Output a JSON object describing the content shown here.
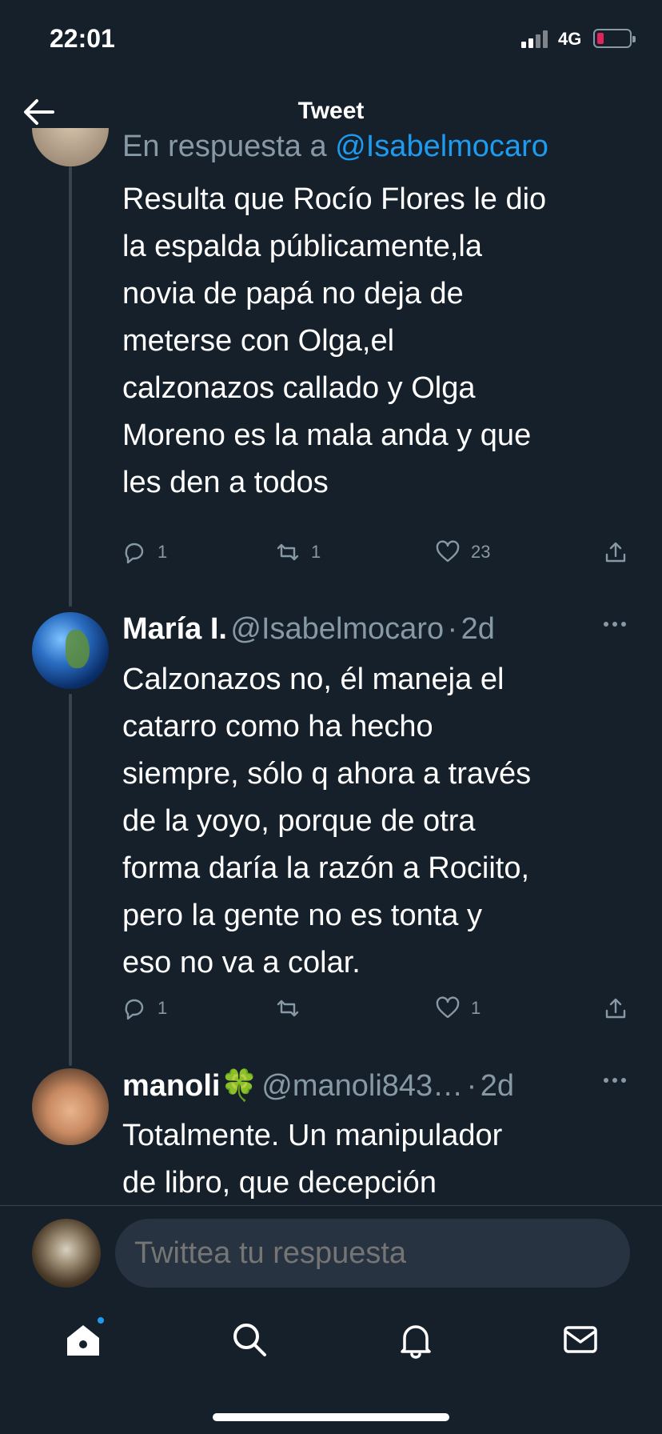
{
  "status_bar": {
    "time": "22:01",
    "network": "4G"
  },
  "header": {
    "title": "Tweet"
  },
  "tweets": [
    {
      "reply_prefix": "En respuesta a ",
      "reply_handle": "@Isabelmocaro",
      "text_lines": [
        "Resulta que Rocío Flores le dio",
        "la espalda públicamente,la",
        "novia de papá no deja de",
        "meterse con Olga,el",
        "calzonazos callado y Olga",
        "Moreno es la mala anda y que",
        "les den a todos"
      ],
      "replies": "1",
      "retweets": "1",
      "likes": "23"
    },
    {
      "name": "María I.",
      "handle": "@Isabelmocaro",
      "separator": "·",
      "time": "2d",
      "text_lines": [
        "Calzonazos no, él maneja el",
        "catarro como ha hecho",
        "siempre, sólo q ahora a través",
        "de la yoyo, porque de otra",
        "forma daría la razón a Rociito,",
        "pero la gente no es tonta y",
        "eso  no va a colar."
      ],
      "replies": "1",
      "retweets": "",
      "likes": "1"
    },
    {
      "name": "manoli",
      "name_emoji": "🍀",
      "handle": "@manoli843…",
      "separator": "·",
      "time": "2d",
      "text_lines": [
        "Totalmente. Un manipulador",
        "de libro, que decepción"
      ]
    }
  ],
  "composer": {
    "placeholder": "Twittea tu respuesta"
  },
  "colors": {
    "background": "#15202b",
    "accent": "#1d9bf0",
    "muted": "#8899a6",
    "line": "#38444d"
  }
}
